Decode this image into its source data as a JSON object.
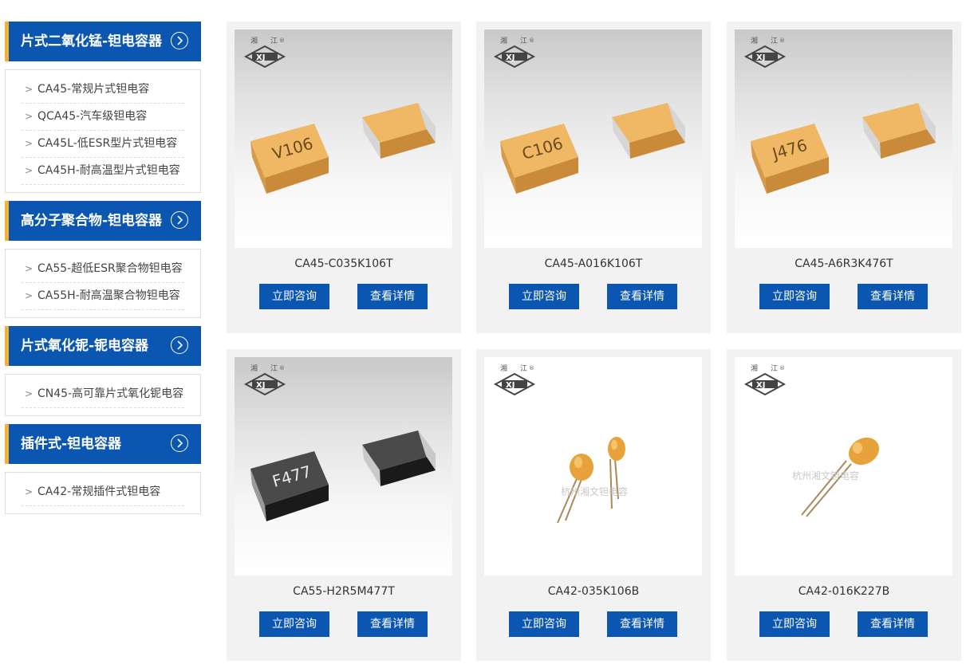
{
  "sidebar": {
    "categories": [
      {
        "title": "片式二氧化锰-钽电容器",
        "items": [
          "CA45-常规片式钽电容",
          "QCA45-汽车级钽电容",
          "CA45L-低ESR型片式钽电容",
          "CA45H-耐高温型片式钽电容"
        ]
      },
      {
        "title": "高分子聚合物-钽电容器",
        "items": [
          "CA55-超低ESR聚合物钽电容",
          "CA55H-耐高温聚合物钽电容"
        ]
      },
      {
        "title": "片式氧化铌-铌电容器",
        "items": [
          "CN45-高可靠片式氧化铌电容"
        ]
      },
      {
        "title": "插件式-钽电容器",
        "items": [
          "CA42-常规插件式钽电容"
        ]
      }
    ]
  },
  "products": [
    {
      "name": "CA45-C035K106T",
      "marking": "V106",
      "style": "yellow-chip"
    },
    {
      "name": "CA45-A016K106T",
      "marking": "C106",
      "style": "yellow-chip"
    },
    {
      "name": "CA45-A6R3K476T",
      "marking": "J476",
      "style": "yellow-chip"
    },
    {
      "name": "CA55-H2R5M477T",
      "marking": "F477",
      "style": "black-chip"
    },
    {
      "name": "CA42-035K106B",
      "marking": "",
      "style": "leaded",
      "watermark": "杭州湘文钽电容"
    },
    {
      "name": "CA42-016K227B",
      "marking": "",
      "style": "leaded",
      "watermark": "杭州湘文钽电容"
    }
  ],
  "buttons": {
    "inquiry": "立即咨询",
    "details": "查看详情"
  },
  "logo": {
    "left_char": "湘",
    "right_char": "江",
    "mark": "XJ",
    "reg": "®"
  },
  "colors": {
    "accent": "#0b56b0",
    "highlight": "#f2b233",
    "card_bg": "#f2f2f2"
  },
  "icons": {
    "category_arrow": "chevron-right-circle-icon",
    "item_bullet": "chevron-right-icon"
  }
}
